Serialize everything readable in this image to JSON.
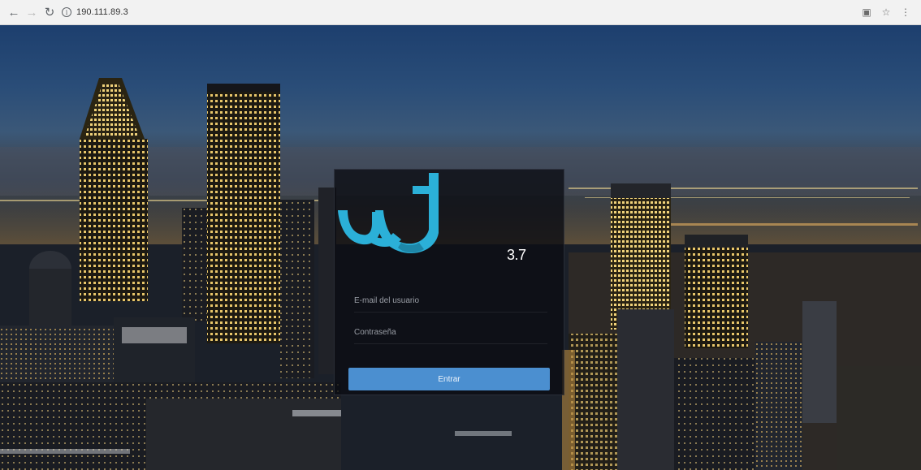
{
  "browser": {
    "url": "190.111.89.3",
    "nav": {
      "back_icon": "arrow-left-icon",
      "forward_icon": "arrow-right-icon",
      "reload_icon": "reload-icon"
    },
    "info_icon": "info-icon",
    "right_icons": [
      "translate-icon",
      "bookmark-star-icon",
      "menu-kebab-icon"
    ]
  },
  "login": {
    "logo_icon": "wj-logo",
    "version": "3.7",
    "email_placeholder": "E-mail del usuario",
    "password_placeholder": "Contraseña",
    "submit_label": "Entrar"
  },
  "colors": {
    "accent": "#4b8fd0",
    "logo": "#2bb0d8",
    "panel": "#0a0c12"
  }
}
